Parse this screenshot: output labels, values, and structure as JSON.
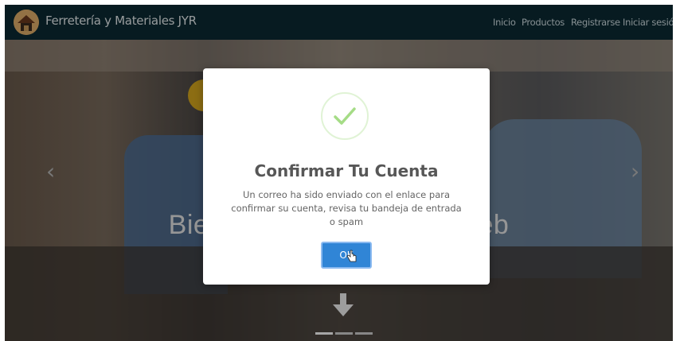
{
  "navbar": {
    "brand": "Ferretería y Materiales JYR",
    "links": [
      "Inicio",
      "Productos",
      "Registrarse",
      "Iniciar sesión"
    ]
  },
  "hero": {
    "title": "Bienvenidos a nuestra Web",
    "slide_count": 3,
    "active_slide": 1
  },
  "modal": {
    "title": "Confirmar Tu Cuenta",
    "message": "Un correo ha sido enviado con el enlace para confirmar su cuenta, revisa tu bandeja de entrada o spam",
    "button_label": "OK",
    "icon": "success-check-icon"
  },
  "colors": {
    "navbar": "#0b2a33",
    "button": "#3085d6",
    "check": "#a5dc86"
  }
}
